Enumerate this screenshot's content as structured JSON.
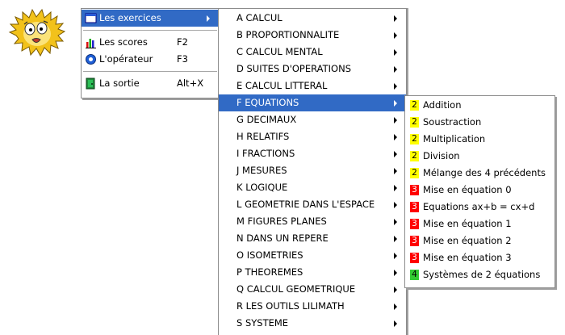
{
  "main_menu": {
    "items": [
      {
        "label": "Les exercices",
        "icon": "window-icon"
      },
      {
        "label": "Les scores",
        "shortcut": "F2",
        "icon": "bar-chart-icon"
      },
      {
        "label": "L'opérateur",
        "shortcut": "F3",
        "icon": "operator-icon"
      },
      {
        "label": "La sortie",
        "shortcut": "Alt+X",
        "icon": "exit-door-icon"
      }
    ]
  },
  "categories": {
    "items": [
      "A CALCUL",
      "B PROPORTIONNALITE",
      "C CALCUL MENTAL",
      "D SUITES D'OPERATIONS",
      "E CALCUL LITTERAL",
      "F EQUATIONS",
      "G DECIMAUX",
      "H RELATIFS",
      "I FRACTIONS",
      "J MESURES",
      "K LOGIQUE",
      "L GEOMETRIE DANS L'ESPACE",
      "M FIGURES PLANES",
      "N DANS UN REPERE",
      "O ISOMETRIES",
      "P THEOREMES",
      "Q CALCUL GEOMETRIQUE",
      "R LES OUTILS LILIMATH",
      "S SYSTEME"
    ],
    "selected": "F EQUATIONS"
  },
  "exercises": {
    "items": [
      {
        "level": "2",
        "label": "Addition"
      },
      {
        "level": "2",
        "label": "Soustraction"
      },
      {
        "level": "2",
        "label": "Multiplication"
      },
      {
        "level": "2",
        "label": "Division"
      },
      {
        "level": "2",
        "label": "Mélange des 4 précédents"
      },
      {
        "level": "3",
        "label": "Mise en équation 0"
      },
      {
        "level": "3",
        "label": "Equations ax+b = cx+d"
      },
      {
        "level": "3",
        "label": "Mise en équation 1"
      },
      {
        "level": "3",
        "label": "Mise en équation 2"
      },
      {
        "level": "3",
        "label": "Mise en équation 3"
      },
      {
        "level": "4",
        "label": "Systèmes de 2 équations"
      }
    ]
  },
  "colors": {
    "selection": "#316ac5",
    "level2": "#ffff00",
    "level3": "#ff0000",
    "level4": "#33cc33"
  }
}
